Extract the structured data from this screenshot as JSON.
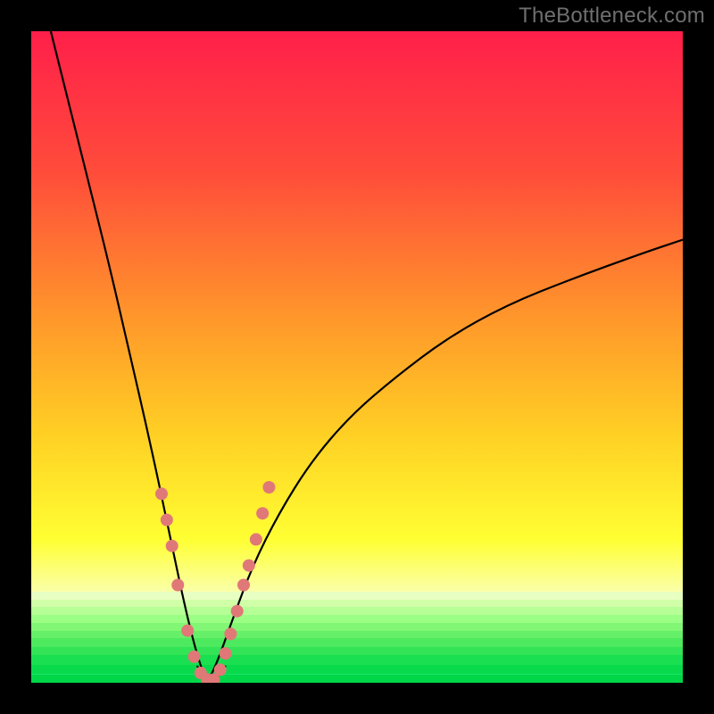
{
  "watermark": "TheBottleneck.com",
  "chart_data": {
    "type": "line",
    "title": "",
    "xlabel": "",
    "ylabel": "",
    "xlim": [
      0,
      100
    ],
    "ylim": [
      0,
      100
    ],
    "grid": false,
    "legend": false,
    "background": {
      "style": "vertical-gradient",
      "stops": [
        {
          "pos": 0.0,
          "color": "#ff1f4a"
        },
        {
          "pos": 0.22,
          "color": "#ff4d3a"
        },
        {
          "pos": 0.45,
          "color": "#ff9a2a"
        },
        {
          "pos": 0.62,
          "color": "#ffd024"
        },
        {
          "pos": 0.78,
          "color": "#ffff33"
        },
        {
          "pos": 0.86,
          "color": "#faffa8"
        },
        {
          "pos": 0.89,
          "color": "#d7ffb0"
        },
        {
          "pos": 1.0,
          "color": "#00e060"
        }
      ],
      "green_band_stripes": [
        {
          "top_pct": 86.0,
          "height_pct": 1.2,
          "color": "#e8ffc2"
        },
        {
          "top_pct": 87.2,
          "height_pct": 1.2,
          "color": "#d0ffa8"
        },
        {
          "top_pct": 88.4,
          "height_pct": 1.2,
          "color": "#b6ff96"
        },
        {
          "top_pct": 89.6,
          "height_pct": 1.2,
          "color": "#9cff85"
        },
        {
          "top_pct": 90.8,
          "height_pct": 1.2,
          "color": "#82f675"
        },
        {
          "top_pct": 92.0,
          "height_pct": 1.2,
          "color": "#66ef68"
        },
        {
          "top_pct": 93.2,
          "height_pct": 1.3,
          "color": "#4de95e"
        },
        {
          "top_pct": 94.5,
          "height_pct": 1.3,
          "color": "#33e456"
        },
        {
          "top_pct": 95.8,
          "height_pct": 1.4,
          "color": "#1adf50"
        },
        {
          "top_pct": 97.2,
          "height_pct": 1.5,
          "color": "#08da4c"
        },
        {
          "top_pct": 98.7,
          "height_pct": 1.3,
          "color": "#00d648"
        }
      ]
    },
    "series": [
      {
        "name": "bottleneck-curve",
        "note": "Two branches meeting near x≈27 at y≈0; y is mismatch/bottleneck percentage.",
        "x": [
          3,
          6,
          9,
          12,
          15,
          18,
          21,
          23.5,
          25.5,
          27,
          28.5,
          31,
          34,
          38,
          43,
          49,
          56,
          64,
          73,
          83,
          94,
          100
        ],
        "y": [
          100,
          88,
          76,
          64,
          51,
          38,
          24,
          12,
          4,
          0,
          3,
          10,
          18,
          26,
          34,
          41,
          47,
          53,
          58,
          62,
          66,
          68
        ]
      }
    ],
    "annotations": {
      "dotted_cluster": {
        "description": "Salmon-pink dots and short connector along the valley of the curve",
        "dots_xy": [
          [
            20.0,
            29
          ],
          [
            20.8,
            25
          ],
          [
            21.6,
            21
          ],
          [
            22.5,
            15
          ],
          [
            24.0,
            8
          ],
          [
            25.0,
            4
          ],
          [
            26.0,
            1.5
          ],
          [
            27.0,
            0.5
          ],
          [
            28.0,
            0.5
          ],
          [
            29.0,
            2
          ],
          [
            29.8,
            4.5
          ],
          [
            30.6,
            7.5
          ],
          [
            31.6,
            11
          ],
          [
            32.6,
            15
          ],
          [
            33.4,
            18
          ],
          [
            34.5,
            22
          ],
          [
            35.5,
            26
          ],
          [
            36.5,
            30
          ]
        ],
        "dot_radius_px": 7,
        "connector_path_xy": [
          [
            25.5,
            2.5
          ],
          [
            27.0,
            0.8
          ],
          [
            28.5,
            0.8
          ],
          [
            29.8,
            2.5
          ]
        ],
        "color": "#e07878"
      }
    }
  }
}
